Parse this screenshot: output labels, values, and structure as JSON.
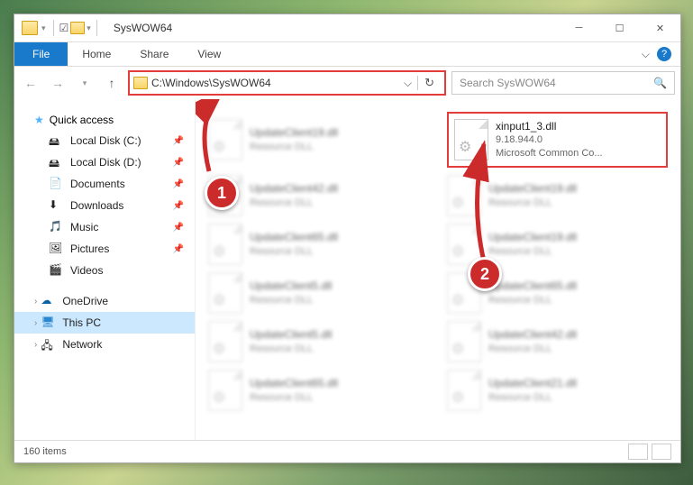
{
  "window": {
    "title": "SysWOW64"
  },
  "ribbon": {
    "file": "File",
    "home": "Home",
    "share": "Share",
    "view": "View"
  },
  "address": {
    "path": "C:\\Windows\\SysWOW64"
  },
  "search": {
    "placeholder": "Search SysWOW64"
  },
  "sidebar": {
    "quick": "Quick access",
    "items": [
      {
        "label": "Local Disk (C:)"
      },
      {
        "label": "Local Disk (D:)"
      },
      {
        "label": "Documents"
      },
      {
        "label": "Downloads"
      },
      {
        "label": "Music"
      },
      {
        "label": "Pictures"
      },
      {
        "label": "Videos"
      }
    ],
    "onedrive": "OneDrive",
    "thispc": "This PC",
    "network": "Network"
  },
  "highlighted_file": {
    "name": "xinput1_3.dll",
    "version": "9.18.944.0",
    "desc": "Microsoft Common Co..."
  },
  "blurfiles": {
    "r1c1": "UpdateClient19.dll",
    "s1": "Resource DLL",
    "r2c1": "UpdateClient42.dll",
    "r3c1": "UpdateClient65.dll",
    "r4c1": "UpdateClient5.dll",
    "r5c1": "UpdateClient5.dll",
    "r6c1": "UpdateClient65.dll",
    "r2c2": "UpdateClient19.dll",
    "r3c2": "UpdateClient19.dll",
    "r4c2": "UpdateClient65.dll",
    "r5c2": "UpdateClient42.dll",
    "r6c2": "UpdateClient21.dll"
  },
  "status": {
    "count": "160 items"
  },
  "callouts": {
    "c1": "1",
    "c2": "2"
  }
}
